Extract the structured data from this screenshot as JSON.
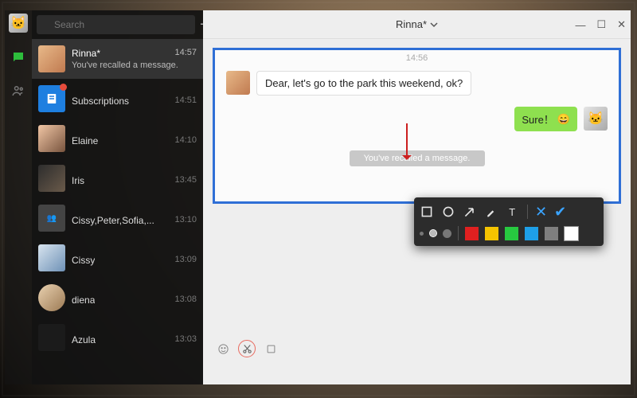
{
  "search": {
    "placeholder": "Search"
  },
  "sidebar": {
    "items": [
      {
        "name": "Rinna*",
        "time": "14:57",
        "preview": "You've recalled a message."
      },
      {
        "name": "Subscriptions",
        "time": "14:51",
        "preview": ""
      },
      {
        "name": "Elaine",
        "time": "14:10",
        "preview": ""
      },
      {
        "name": "Iris",
        "time": "13:45",
        "preview": ""
      },
      {
        "name": "Cissy,Peter,Sofia,...",
        "time": "13:10",
        "preview": ""
      },
      {
        "name": "Cissy",
        "time": "13:09",
        "preview": ""
      },
      {
        "name": "diena",
        "time": "13:08",
        "preview": ""
      },
      {
        "name": "Azula",
        "time": "13:03",
        "preview": ""
      }
    ]
  },
  "header": {
    "title": "Rinna*"
  },
  "conversation": {
    "timestamp": "14:56",
    "incoming": "Dear, let's go to the park this weekend, ok?",
    "outgoing": "Sure！",
    "outgoing_emoji": "😄",
    "recall_notice": "You've recalled a message."
  },
  "annotation": {
    "colors": [
      "#e02020",
      "#f5c400",
      "#27c940",
      "#1e9fe8",
      "#7f7f7f",
      "#ffffff"
    ]
  }
}
